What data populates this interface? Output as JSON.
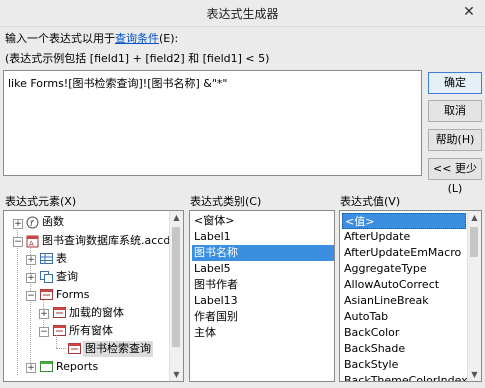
{
  "window": {
    "title": "表达式生成器",
    "close_glyph": "✕"
  },
  "prompt": {
    "text": "输入一个表达式以用于",
    "link": "查询条件",
    "suffix": "(E):"
  },
  "example": "(表达式示例包括 [field1] + [field2] 和 [field1] < 5)",
  "expression": "like Forms![图书检索查询]![图书名称] &\"*\"",
  "buttons": {
    "ok": "确定",
    "cancel": "取消",
    "help": "帮助(H)",
    "less": "<< 更少(L)"
  },
  "panels": {
    "elements": {
      "label": "表达式元素(X)",
      "items": [
        {
          "label": "函数",
          "icon": "function-icon"
        },
        {
          "label": "图书查询数据库系统.accdb",
          "icon": "database-icon"
        },
        {
          "label": "表",
          "icon": "table-icon"
        },
        {
          "label": "查询",
          "icon": "query-icon"
        },
        {
          "label": "Forms",
          "icon": "form-icon"
        },
        {
          "label": "加载的窗体",
          "icon": "form-icon"
        },
        {
          "label": "所有窗体",
          "icon": "form-icon"
        },
        {
          "label": "图书检索查询",
          "icon": "form-icon"
        },
        {
          "label": "Reports",
          "icon": "report-icon"
        }
      ]
    },
    "categories": {
      "label": "表达式类别(C)",
      "items": [
        "<窗体>",
        "Label1",
        "图书名称",
        "Label5",
        "图书作者",
        "Label13",
        "作者国别",
        "主体"
      ],
      "selected_index": 2
    },
    "values": {
      "label": "表达式值(V)",
      "items": [
        "<值>",
        "AfterUpdate",
        "AfterUpdateEmMacro",
        "AggregateType",
        "AllowAutoCorrect",
        "AsianLineBreak",
        "AutoTab",
        "BackColor",
        "BackShade",
        "BackStyle",
        "BackThemeColorIndex"
      ],
      "selected_index": 0
    }
  },
  "colors": {
    "selection": "#3c8fe0",
    "link": "#0050c8"
  }
}
